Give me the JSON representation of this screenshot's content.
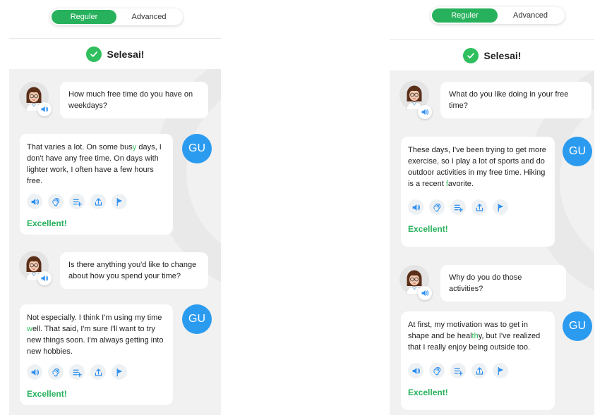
{
  "colors": {
    "accent_green": "#27b15c",
    "user_avatar_blue": "#2b9bf0",
    "icon_blue": "#2b8ff0",
    "chat_background": "#f1f1f1"
  },
  "left": {
    "mode_toggle": {
      "regular": "Reguler",
      "advanced": "Advanced"
    },
    "status": {
      "label": "Selesai!",
      "icon": "check-icon"
    },
    "conversation": [
      {
        "question": "How much free time do you have on weekdays?",
        "user_avatar": "GU",
        "answer": {
          "before": "That varies a lot. On some bus",
          "highlight": "y",
          "after": " days, I don't have any free time. On days with lighter work, I often have a few hours free."
        },
        "result": "Excellent!"
      },
      {
        "question": "Is there anything you'd like to change about how you spend your time?",
        "user_avatar": "GU",
        "answer": {
          "before": "Not especially. I think I'm using my time ",
          "highlight": "w",
          "after": "ell. That said, I'm sure I'll want to try new things soon. I'm always getting into new hobbies."
        },
        "result": "Excellent!"
      }
    ]
  },
  "right": {
    "mode_toggle": {
      "regular": "Reguler",
      "advanced": "Advanced"
    },
    "status": {
      "label": "Selesai!",
      "icon": "check-icon"
    },
    "conversation": [
      {
        "question": "What do you like doing in your free time?",
        "user_avatar": "GU",
        "answer": {
          "before": "These days, I've been trying to get more exercise, so I play a lot of sports and do outdoor activities in my free time. Hiking is a recent ",
          "highlight": "f",
          "after": "avorite."
        },
        "result": "Excellent!"
      },
      {
        "question": "Why do you do those activities?",
        "user_avatar": "GU",
        "answer": {
          "before": "At first, my motivation was to get in shape and be heal",
          "highlight": "th",
          "after": "y, but I've realized that I really enjoy being outside too."
        },
        "result": "Excellent!"
      }
    ]
  },
  "toolbar_icons": [
    "speaker-icon",
    "ear-icon",
    "add-to-list-icon",
    "share-icon",
    "flag-icon"
  ]
}
